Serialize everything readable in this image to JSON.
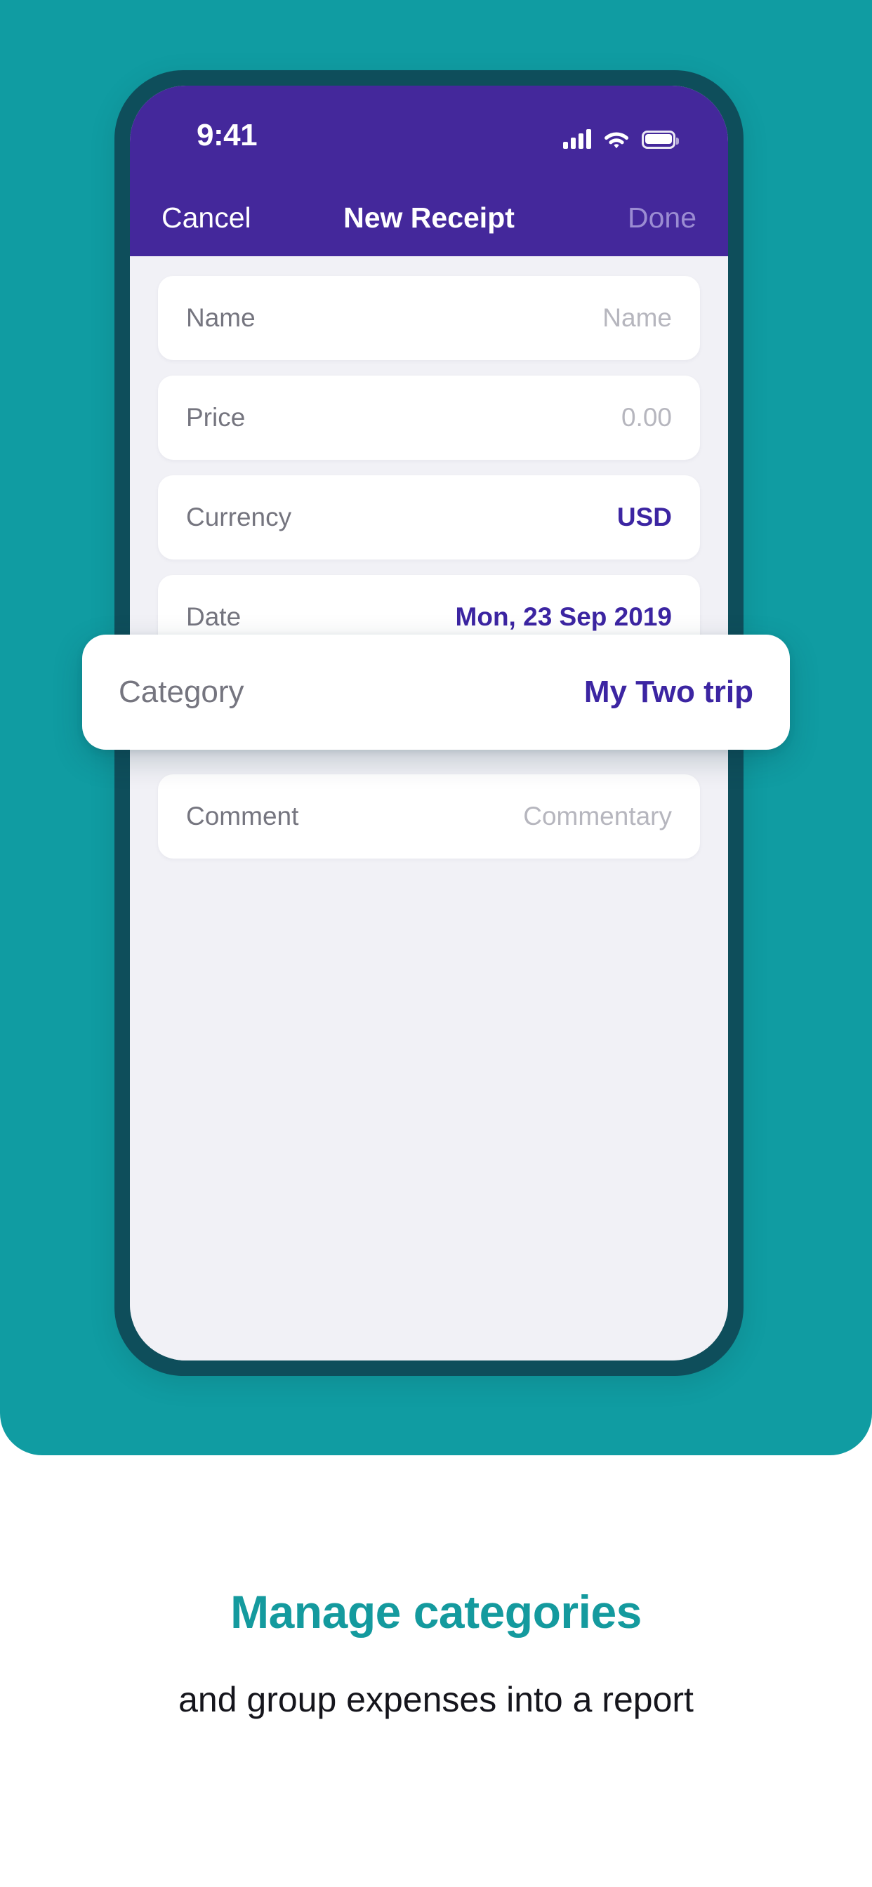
{
  "hero": {
    "background_color": "#109CA2"
  },
  "device": {
    "bezel_color": "#0E4E5B",
    "screen_background": "#F1F1F6"
  },
  "status_bar": {
    "time": "9:41",
    "background_color": "#44289B",
    "icons": [
      "signal-icon",
      "wifi-icon",
      "battery-icon"
    ],
    "battery_full": true,
    "signal_bars": 4
  },
  "nav_bar": {
    "cancel_label": "Cancel",
    "title": "New Receipt",
    "done_label": "Done",
    "done_disabled": true,
    "background_color": "#44289B",
    "done_color": "#9B8CD2"
  },
  "form": {
    "accent_color": "#3C25A2",
    "rows": [
      {
        "label": "Name",
        "value": "Name",
        "style": "placeholder"
      },
      {
        "label": "Price",
        "value": "0.00",
        "style": "placeholder"
      },
      {
        "label": "Currency",
        "value": "USD",
        "style": "accent"
      },
      {
        "label": "Date",
        "value": "Mon, 23 Sep 2019",
        "style": "accent"
      },
      {
        "label": "Comment",
        "value": "Commentary",
        "style": "placeholder"
      }
    ],
    "highlighted_row": {
      "label": "Category",
      "value": "My Two trip",
      "style": "accent"
    }
  },
  "caption": {
    "headline": "Manage categories",
    "headline_color": "#149A9E",
    "subhead": "and group expenses into a report",
    "subhead_color": "#15151C"
  }
}
